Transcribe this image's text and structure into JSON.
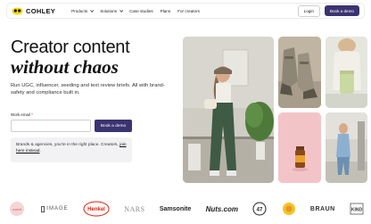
{
  "nav": {
    "brand": "COHLEY",
    "items": [
      {
        "label": "Products",
        "has_dropdown": true
      },
      {
        "label": "Solutions",
        "has_dropdown": true
      },
      {
        "label": "Case studies",
        "has_dropdown": false
      },
      {
        "label": "Plans",
        "has_dropdown": false
      },
      {
        "label": "For creators",
        "has_dropdown": false
      }
    ],
    "login_label": "Login",
    "demo_label": "Book a demo"
  },
  "hero": {
    "title_line1": "Creator content",
    "title_line2": "without chaos",
    "subtitle": "Run UGC, influencer, seeding and text review briefs. All with brand-safety and compliance built in.",
    "email_label": "Work email",
    "email_required_mark": "*",
    "email_value": "",
    "email_placeholder": "",
    "demo_button_label": "Book a demo",
    "notice_text": "Brands & agencies, you're in the right place. Creators,",
    "notice_link": "join here instead",
    "notice_end": "."
  },
  "logos": [
    "Cvent",
    "IMAGE",
    "Henkel",
    "NARS",
    "Samsonite",
    "Nuts.com",
    "47",
    "Cereal brand",
    "BRAUN",
    "KIND"
  ],
  "colors": {
    "accent": "#3b3370",
    "logo_yellow": "#f5d800",
    "notice_bg": "#f2f2f4"
  }
}
